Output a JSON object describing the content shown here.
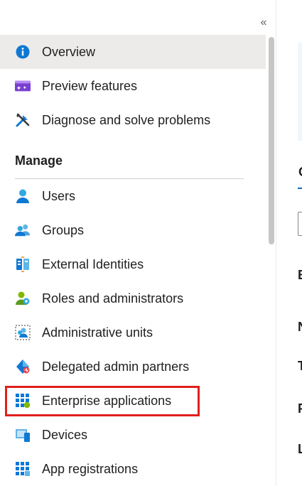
{
  "collapse_glyph": "«",
  "sidebar": {
    "items_top": [
      {
        "label": "Overview",
        "icon": "info-icon",
        "selected": true
      },
      {
        "label": "Preview features",
        "icon": "preview-features-icon"
      },
      {
        "label": "Diagnose and solve problems",
        "icon": "wrench-icon"
      }
    ],
    "section_manage": "Manage",
    "items_manage": [
      {
        "label": "Users",
        "icon": "user-icon"
      },
      {
        "label": "Groups",
        "icon": "groups-icon"
      },
      {
        "label": "External Identities",
        "icon": "external-identities-icon"
      },
      {
        "label": "Roles and administrators",
        "icon": "roles-icon"
      },
      {
        "label": "Administrative units",
        "icon": "admin-units-icon"
      },
      {
        "label": "Delegated admin partners",
        "icon": "delegated-admin-icon"
      },
      {
        "label": "Enterprise applications",
        "icon": "enterprise-apps-icon",
        "highlighted": true
      },
      {
        "label": "Devices",
        "icon": "devices-icon"
      },
      {
        "label": "App registrations",
        "icon": "app-registrations-icon"
      }
    ]
  },
  "right_panel": {
    "tab_partial": "O",
    "label_b": "B",
    "label_n": "N",
    "label_t": "T",
    "label_p": "P",
    "label_l": "L"
  },
  "colors": {
    "accent": "#0f6cbd",
    "highlight_border": "#e0201b",
    "selected_bg": "#edebe9"
  }
}
